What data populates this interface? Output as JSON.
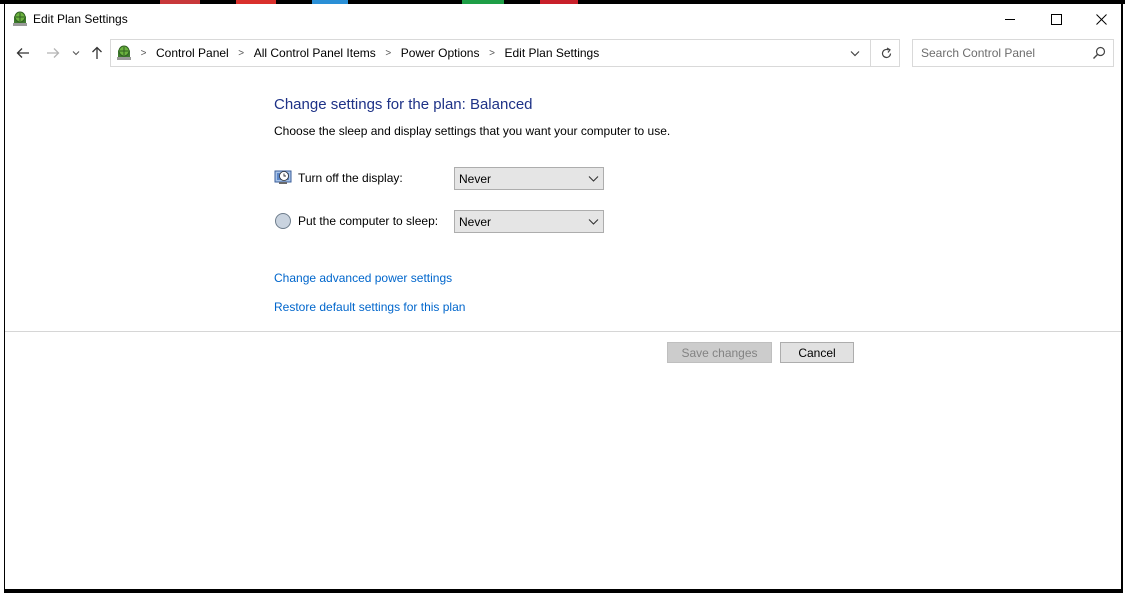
{
  "window": {
    "title": "Edit Plan Settings",
    "controls": {
      "minimize": "minimize",
      "maximize": "maximize",
      "close": "close"
    }
  },
  "nav": {
    "back_icon": "arrow-left-icon",
    "forward_icon": "arrow-right-icon",
    "recent_icon": "chevron-down-icon",
    "up_icon": "arrow-up-icon"
  },
  "address": {
    "icon": "control-panel-icon",
    "crumbs": [
      "Control Panel",
      "All Control Panel Items",
      "Power Options",
      "Edit Plan Settings"
    ],
    "separator": ">",
    "dropdown_icon": "chevron-down-icon",
    "refresh_icon": "refresh-icon"
  },
  "search": {
    "placeholder": "Search Control Panel",
    "value": "",
    "icon": "search-icon"
  },
  "main": {
    "heading": "Change settings for the plan: Balanced",
    "subtext": "Choose the sleep and display settings that you want your computer to use.",
    "settings": [
      {
        "label": "Turn off the display:",
        "value": "Never",
        "icon": "display-icon"
      },
      {
        "label": "Put the computer to sleep:",
        "value": "Never",
        "icon": "sleep-moon-icon"
      }
    ],
    "links": {
      "advanced": "Change advanced power settings",
      "restore": "Restore default settings for this plan"
    }
  },
  "footer": {
    "save_label": "Save changes",
    "cancel_label": "Cancel",
    "save_enabled": false
  },
  "colors": {
    "heading": "#1e3287",
    "link": "#0066cc",
    "disabled_text": "#838383"
  }
}
